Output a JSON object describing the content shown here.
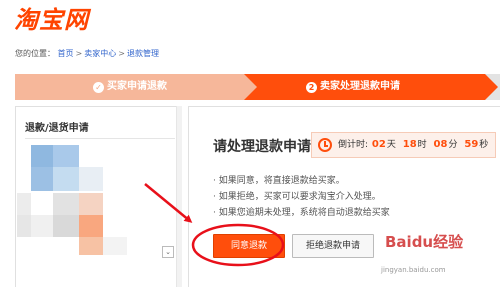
{
  "logo": {
    "text": "淘宝网"
  },
  "breadcrumb": {
    "prefix": "您的位置：",
    "items": [
      "首页",
      "卖家中心",
      "退款管理"
    ],
    "separator": ">"
  },
  "steps": [
    {
      "label": "买家申请退款",
      "icon": "check-icon",
      "state": "done"
    },
    {
      "label": "卖家处理退款申请",
      "number": "2",
      "state": "active"
    }
  ],
  "sidebar": {
    "title": "退款/退货申请",
    "expand_icon": "chevron-down-icon"
  },
  "main": {
    "title": "请处理退款申请",
    "countdown": {
      "label": "倒计时:",
      "days": "02",
      "days_unit": "天",
      "hours": "18",
      "hours_unit": "时",
      "minutes": "08",
      "minutes_unit": "分",
      "seconds": "59",
      "seconds_unit": "秒"
    },
    "notes": [
      "· 如果同意，将直接退款给买家。",
      "· 如果拒绝，买家可以要求淘宝介入处理。",
      "· 如果您逾期未处理，系统将自动退款给买家"
    ],
    "agree_button": "同意退款",
    "reject_button": "拒绝退款申请"
  },
  "colors": {
    "brand": "#ff4400",
    "step_done": "#f6b79a",
    "step_active": "#ff4e0c",
    "annotation": "#e8101a"
  },
  "watermark": {
    "logo": "Baidu经验",
    "url": "jingyan.baidu.com"
  }
}
